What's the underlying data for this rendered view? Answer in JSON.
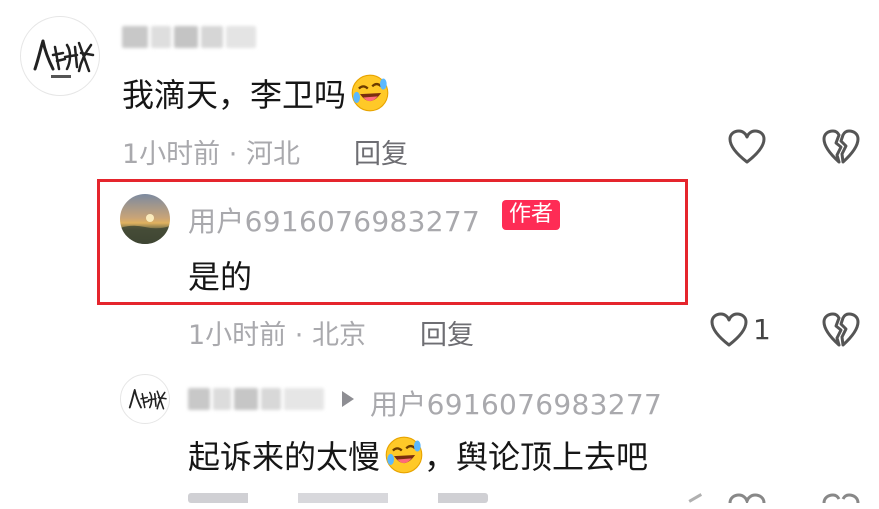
{
  "comments": [
    {
      "username_blurred": true,
      "avatar": "calligraphy-avatar",
      "text": "我滴天，李卫吗",
      "emoji": "rolling-laugh-emoji",
      "time": "1小时前",
      "location": "河北",
      "reply_label": "回复",
      "like_count": ""
    },
    {
      "username": "用户6916076983277",
      "badge": "作者",
      "avatar": "sunset-avatar",
      "text": "是的",
      "time": "1小时前",
      "location": "北京",
      "reply_label": "回复",
      "like_count": "1",
      "highlighted": true
    },
    {
      "username_blurred": true,
      "reply_to": "用户6916076983277",
      "avatar": "calligraphy-avatar",
      "text_before": "起诉来的太慢",
      "emoji": "rolling-laugh-emoji",
      "text_after": "，舆论顶上去吧"
    }
  ],
  "colors": {
    "highlight_border": "#e5252d",
    "author_badge": "#fe2c55",
    "secondary_text": "#a9a9ad",
    "primary_text": "#161616"
  },
  "icons": [
    "heart-outline-icon",
    "broken-heart-icon"
  ]
}
